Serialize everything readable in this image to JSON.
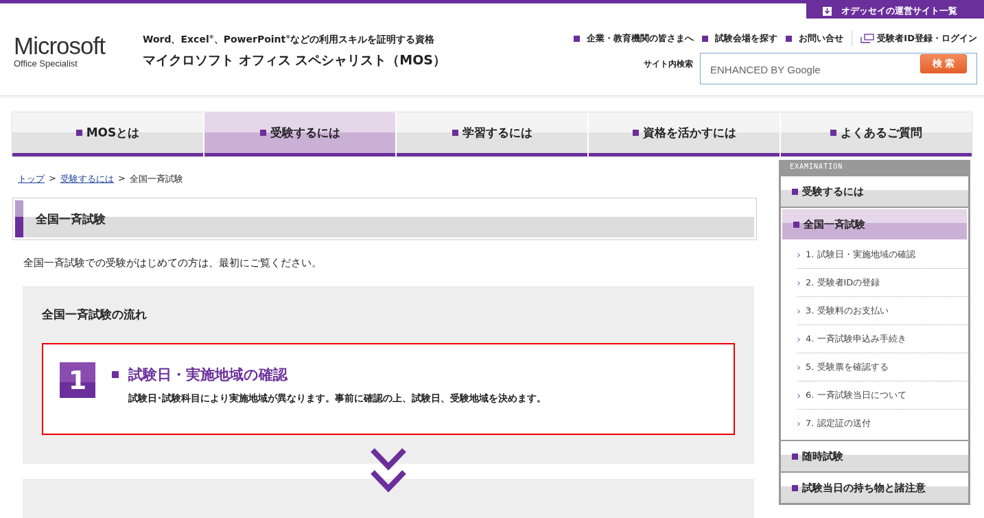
{
  "top_link": "オデッセイの運営サイト一覧",
  "logo": {
    "brand": "Microsoft",
    "sub": "Office Specialist"
  },
  "tagline": "Word、Excel$^{®}$、PowerPoint$^{®}$などの利用スキルを証明する資格",
  "site_title": "マイクロソフト オフィス スペシャリスト（MOS）",
  "header_links": [
    "企業・教育機関の皆さまへ",
    "試験会場を探す",
    "お問い合せ"
  ],
  "login_link": "受験者ID登録・ログイン",
  "search": {
    "label": "サイト内検索",
    "placeholder": "ENHANCED BY Google",
    "button": "検 索"
  },
  "nav": [
    {
      "label": "MOSとは",
      "selected": false
    },
    {
      "label": "受験するには",
      "selected": true
    },
    {
      "label": "学習するには",
      "selected": false
    },
    {
      "label": "資格を活かすには",
      "selected": false
    },
    {
      "label": "よくあるご質問",
      "selected": false
    }
  ],
  "breadcrumb": [
    {
      "label": "トップ",
      "link": true
    },
    {
      "label": "受験するには",
      "link": true
    },
    {
      "label": "全国一斉試験",
      "link": false
    }
  ],
  "breadcrumb_sep": ">",
  "page_title": "全国一斉試験",
  "intro": "全国一斉試験での受験がはじめての方は、最初にご覧ください。",
  "flow": {
    "title": "全国一斉試験の流れ",
    "steps": [
      {
        "number": "1",
        "title": "試験日・実施地域の確認",
        "text": "試験日･試験科目により実施地域が異なります。事前に確認の上、試験日、受験地域を決めます。",
        "highlighted": true
      }
    ]
  },
  "sidebar": {
    "heading": "EXAMINATION",
    "items": [
      {
        "label": "受験するには",
        "selected": false
      },
      {
        "label": "全国一斉試験",
        "selected": true,
        "children": [
          {
            "label": "1. 試験日・実施地域の確認"
          },
          {
            "label": "2. 受験者IDの登録"
          },
          {
            "label": "3. 受験料のお支払い"
          },
          {
            "label": "4. 一斉試験申込み手続き"
          },
          {
            "label": "5. 受験票を確認する"
          },
          {
            "label": "6. 一斉試験当日について"
          },
          {
            "label": "7. 認定証の送付"
          }
        ]
      },
      {
        "label": "随時試験",
        "selected": false
      },
      {
        "label": "試験当日の持ち物と諸注意",
        "selected": false
      }
    ]
  }
}
